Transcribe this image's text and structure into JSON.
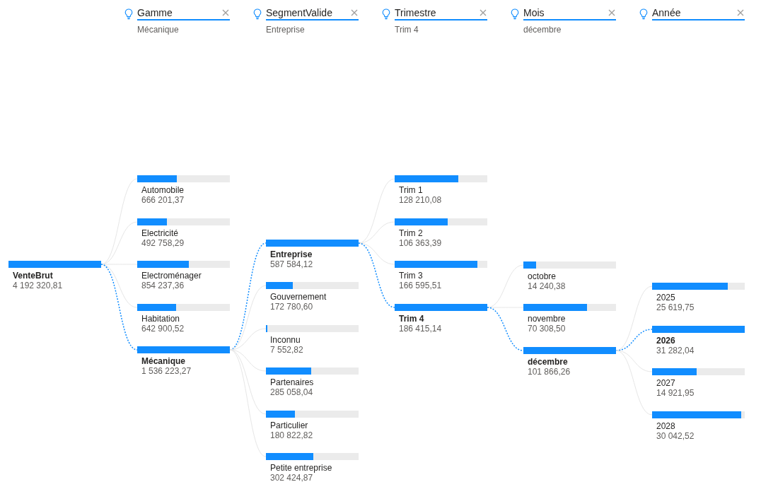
{
  "root": {
    "label": "VenteBrut",
    "value": "4 192 320,81",
    "level": 1,
    "selected": true
  },
  "levels": [
    {
      "field": "Gamme",
      "filter_value": "Mécanique",
      "nodes": [
        {
          "label": "Automobile",
          "value": "666 201,37",
          "level": 0.43,
          "selected": false
        },
        {
          "label": "Electricité",
          "value": "492 758,29",
          "level": 0.32,
          "selected": false
        },
        {
          "label": "Electroménager",
          "value": "854 237,36",
          "level": 0.56,
          "selected": false
        },
        {
          "label": "Habitation",
          "value": "642 900,52",
          "level": 0.42,
          "selected": false
        },
        {
          "label": "Mécanique",
          "value": "1 536 223,27",
          "level": 1,
          "selected": true
        }
      ]
    },
    {
      "field": "SegmentValide",
      "filter_value": "Entreprise",
      "nodes": [
        {
          "label": "Entreprise",
          "value": "587 584,12",
          "level": 1,
          "selected": true
        },
        {
          "label": "Gouvernement",
          "value": "172 780,60",
          "level": 0.29,
          "selected": false
        },
        {
          "label": "Inconnu",
          "value": "7 552,82",
          "level": 0.013,
          "selected": false
        },
        {
          "label": "Partenaires",
          "value": "285 058,04",
          "level": 0.49,
          "selected": false
        },
        {
          "label": "Particulier",
          "value": "180 822,82",
          "level": 0.31,
          "selected": false
        },
        {
          "label": "Petite entreprise",
          "value": "302 424,87",
          "level": 0.51,
          "selected": false
        }
      ]
    },
    {
      "field": "Trimestre",
      "filter_value": "Trim 4",
      "nodes": [
        {
          "label": "Trim 1",
          "value": "128 210,08",
          "level": 0.69,
          "selected": false
        },
        {
          "label": "Trim 2",
          "value": "106 363,39",
          "level": 0.57,
          "selected": false
        },
        {
          "label": "Trim 3",
          "value": "166 595,51",
          "level": 0.89,
          "selected": false
        },
        {
          "label": "Trim 4",
          "value": "186 415,14",
          "level": 1,
          "selected": true
        }
      ]
    },
    {
      "field": "Mois",
      "filter_value": "décembre",
      "nodes": [
        {
          "label": "octobre",
          "value": "14 240,38",
          "level": 0.14,
          "selected": false
        },
        {
          "label": "novembre",
          "value": "70 308,50",
          "level": 0.69,
          "selected": false
        },
        {
          "label": "décembre",
          "value": "101 866,26",
          "level": 1,
          "selected": true
        }
      ]
    },
    {
      "field": "Année",
      "nodes": [
        {
          "label": "2025",
          "value": "25 619,75",
          "level": 0.82,
          "selected": false
        },
        {
          "label": "2026",
          "value": "31 282,04",
          "level": 1,
          "selected": true
        },
        {
          "label": "2027",
          "value": "14 921,95",
          "level": 0.48,
          "selected": false
        },
        {
          "label": "2028",
          "value": "30 042,52",
          "level": 0.96,
          "selected": false
        }
      ]
    }
  ]
}
